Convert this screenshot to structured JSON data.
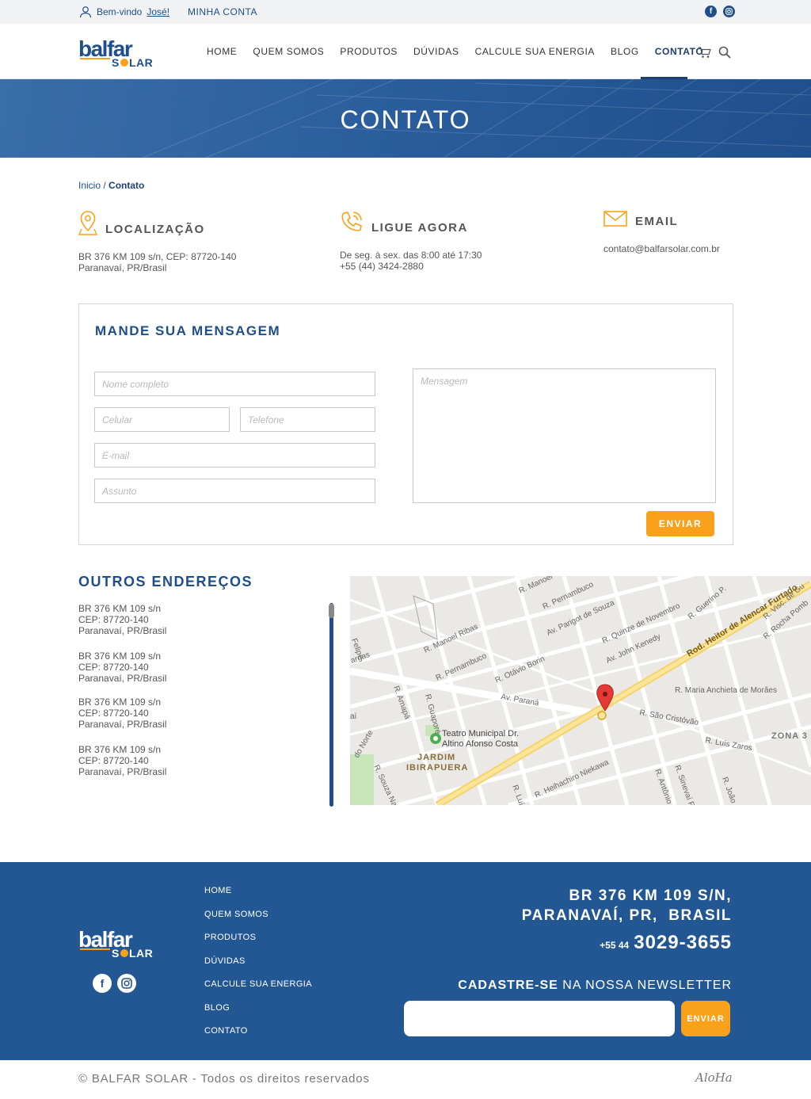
{
  "topbar": {
    "welcome_prefix": "Bem-vindo",
    "welcome_name": "José!",
    "account": "MINHA CONTA"
  },
  "nav": {
    "items": [
      "HOME",
      "QUEM SOMOS",
      "PRODUTOS",
      "DÚVIDAS",
      "CALCULE SUA ENERGIA",
      "BLOG",
      "CONTATO"
    ],
    "active": "CONTATO"
  },
  "hero": {
    "title": "CONTATO"
  },
  "breadcrumb": {
    "home": "Inicio",
    "separator": "/",
    "current": "Contato"
  },
  "info": {
    "location": {
      "title": "LOCALIZAÇÃO",
      "line1": "BR 376 KM 109 s/n, CEP: 87720-140",
      "line2": "Paranavaí, PR/Brasil"
    },
    "phone": {
      "title": "LIGUE AGORA",
      "line1": "De seg. à sex. das 8:00 até 17:30",
      "line2": "+55 (44) 3424-2880"
    },
    "email": {
      "title": "EMAIL",
      "line1": "contato@balfarsolar.com.br"
    }
  },
  "form": {
    "title": "MANDE SUA MENSAGEM",
    "name_placeholder": "Nome completo",
    "cell_placeholder": "Celular",
    "phone_placeholder": "Telefone",
    "email_placeholder": "E-mail",
    "subject_placeholder": "Assunto",
    "message_placeholder": "Mensagem",
    "submit": "ENVIAR"
  },
  "outros": {
    "title": "OUTROS ENDEREÇOS",
    "addresses": [
      {
        "l1": "BR 376 KM 109 s/n",
        "l2": "CEP: 87720-140",
        "l3": "Paranavaí, PR/Brasil"
      },
      {
        "l1": "BR 376 KM 109 s/n",
        "l2": "CEP: 87720-140",
        "l3": "Paranavaí, PR/Brasil"
      },
      {
        "l1": "BR 376 KM 109 s/n",
        "l2": "CEP: 87720-140",
        "l3": "Paranavaí, PR/Brasil"
      },
      {
        "l1": "BR 376 KM 109 s/n",
        "l2": "CEP: 87720-140",
        "l3": "Paranavaí, PR/Brasil"
      }
    ]
  },
  "map": {
    "labels": {
      "r_manoel": "R. Manoel",
      "r_pernambuco_top": "R. Pernambuco",
      "av_parigot": "Av. Parigot de Souza",
      "r_quinze": "R. Quinze de Novembro",
      "r_guerino": "R. Guerino P.",
      "r_visc": "R. Visc. de Gu",
      "r_rocha": "R. Rocha Pomb",
      "rod_heitor": "Rod. Heitor de Alencar Furtado",
      "av_john": "Av. John Kenedy",
      "r_manoel_ribas": "R. Manoel Ribas",
      "felipe": "Felipe",
      "r_pernambuco": "R. Pernambuco",
      "r_otavio": "R. Otávio Borin",
      "r_maria": "R. Maria Anchieta de Morães",
      "av_parana": "Av. Paraná",
      "r_sao_cristovao": "R. São Cristóvão",
      "argas": "argas",
      "r_amapa": "R. Amapá",
      "r_guapore": "R. Guaporé",
      "teatro": "Teatro Municipal Dr.",
      "teatro2": "Altino Afonso Costa",
      "zona3": "ZONA 3",
      "r_luis_zaros": "R. Luís Zaros",
      "jardim": "JARDIM",
      "ibirapuera": "IBIRAPUERA",
      "do_norte": "do Norte",
      "r_souza": "R. Souza Nave",
      "r_heihachiro": "R. Heihachiro Niekawa",
      "r_luis": "R. Luís",
      "r_antonio": "R. Antônio",
      "r_sinevat": "R. Sinevaí F.",
      "r_joao": "R. João",
      "ai": "aí"
    }
  },
  "footer": {
    "links": [
      "HOME",
      "QUEM SOMOS",
      "PRODUTOS",
      "DÚVIDAS",
      "CALCULE SUA ENERGIA",
      "BLOG",
      "CONTATO"
    ],
    "address_line1": "BR 376 KM 109 S/N,",
    "address_line2": "PARANAVAÍ, PR,  BRASIL",
    "phone_prefix": "+55 44",
    "phone_number": "3029-3655",
    "newsletter_bold": "CADASTRE-SE",
    "newsletter_rest": " NA NOSSA NEWSLETTER",
    "newsletter_button": "ENVIAR"
  },
  "bottom": {
    "copyright": "© BALFAR SOLAR - Todos os direitos reservados",
    "credit": "AloHa"
  },
  "colors": {
    "primary": "#1f4e8a",
    "footer": "#235793",
    "accent": "#f9a11b"
  }
}
